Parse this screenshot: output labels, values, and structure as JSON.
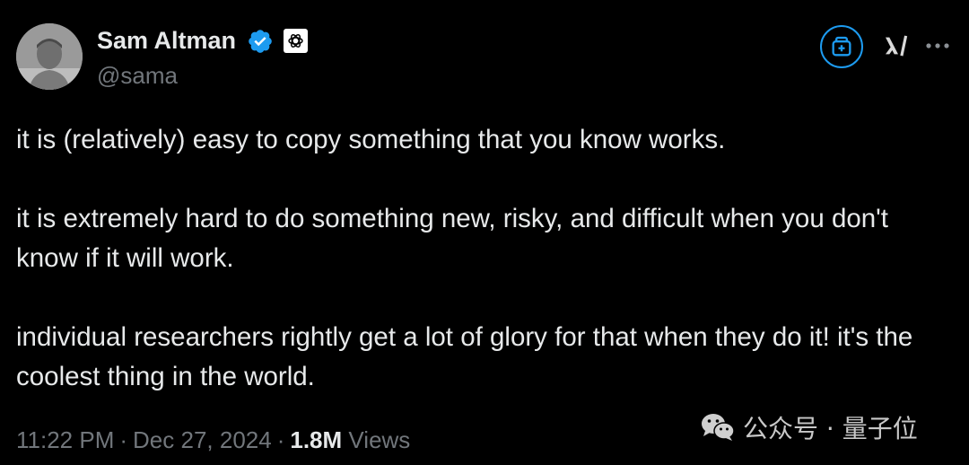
{
  "author": {
    "name": "Sam Altman",
    "handle": "@sama",
    "verified_icon": "verified-badge-icon",
    "org_badge_icon": "openai-logo-icon"
  },
  "header_actions": {
    "grok_icon": "grok-add-icon",
    "xai_icon": "xai-logo-icon",
    "more_icon": "more-dots-icon"
  },
  "tweet": {
    "paragraphs": [
      "it is (relatively) easy to copy something that you know works.",
      "it is extremely hard to do something new, risky, and difficult when you don't know if it will work.",
      "individual researchers rightly get a lot of glory for that when they do it! it's the coolest thing in the world."
    ]
  },
  "meta": {
    "time": "11:22 PM",
    "separator": "·",
    "date": "Dec 27, 2024",
    "views_count": "1.8M",
    "views_label": "Views"
  },
  "watermark": {
    "icon": "wechat-icon",
    "text": "公众号 · 量子位"
  },
  "colors": {
    "background": "#000000",
    "text": "#e7e9ea",
    "muted": "#71767b",
    "accent": "#1d9bf0"
  }
}
